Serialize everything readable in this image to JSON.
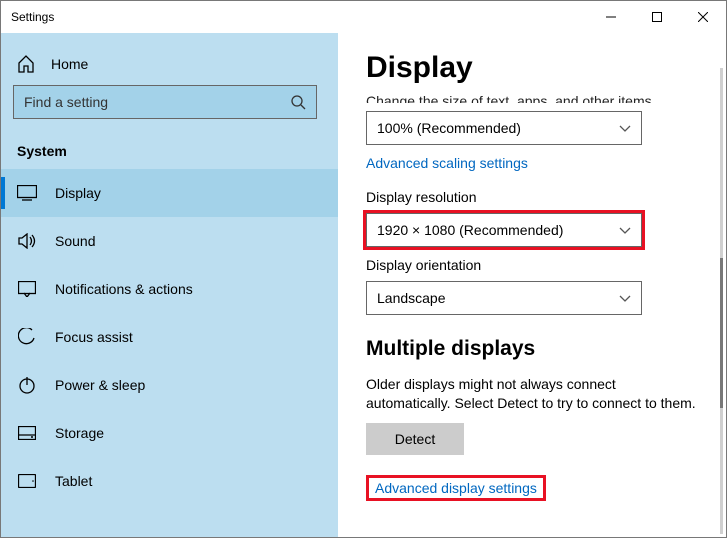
{
  "window": {
    "title": "Settings"
  },
  "sidebar": {
    "home": "Home",
    "search_placeholder": "Find a setting",
    "category": "System",
    "items": [
      {
        "label": "Display"
      },
      {
        "label": "Sound"
      },
      {
        "label": "Notifications & actions"
      },
      {
        "label": "Focus assist"
      },
      {
        "label": "Power & sleep"
      },
      {
        "label": "Storage"
      },
      {
        "label": "Tablet"
      }
    ]
  },
  "main": {
    "heading": "Display",
    "truncated": "Change the size of text, apps, and other items",
    "scale_value": "100% (Recommended)",
    "adv_scaling": "Advanced scaling settings",
    "resolution_label": "Display resolution",
    "resolution_value": "1920 × 1080 (Recommended)",
    "orientation_label": "Display orientation",
    "orientation_value": "Landscape",
    "multi_heading": "Multiple displays",
    "multi_desc": "Older displays might not always connect automatically. Select Detect to try to connect to them.",
    "detect_label": "Detect",
    "adv_display": "Advanced display settings"
  }
}
